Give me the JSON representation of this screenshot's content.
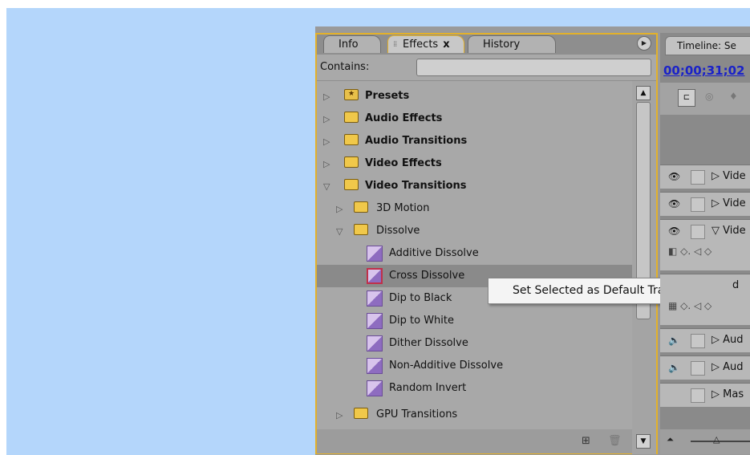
{
  "effects_panel": {
    "tabs": [
      {
        "label": "Info"
      },
      {
        "label": "Effects"
      },
      {
        "label": "History"
      }
    ],
    "close_glyph": "x",
    "contains_label": "Contains:",
    "contains_value": "",
    "tree": [
      {
        "label": "Presets",
        "twisty": "▷",
        "icon": "preset-folder-icon",
        "bold": true
      },
      {
        "label": "Audio Effects",
        "twisty": "▷",
        "icon": "folder-icon",
        "bold": true
      },
      {
        "label": "Audio Transitions",
        "twisty": "▷",
        "icon": "folder-icon",
        "bold": true
      },
      {
        "label": "Video Effects",
        "twisty": "▷",
        "icon": "folder-icon",
        "bold": true
      },
      {
        "label": "Video Transitions",
        "twisty": "▽",
        "icon": "folder-icon",
        "bold": true
      },
      {
        "label": "3D Motion",
        "twisty": "▷",
        "icon": "folder-icon"
      },
      {
        "label": "Dissolve",
        "twisty": "▽",
        "icon": "folder-icon"
      },
      {
        "label": "Additive Dissolve",
        "icon": "transition-icon"
      },
      {
        "label": "Cross Dissolve",
        "icon": "transition-icon",
        "selected": true
      },
      {
        "label": "Dip to Black",
        "icon": "transition-icon"
      },
      {
        "label": "Dip to White",
        "icon": "transition-icon"
      },
      {
        "label": "Dither Dissolve",
        "icon": "transition-icon"
      },
      {
        "label": "Non-Additive Dissolve",
        "icon": "transition-icon"
      },
      {
        "label": "Random Invert",
        "icon": "transition-icon"
      },
      {
        "label": "GPU Transitions",
        "twisty": "▷",
        "icon": "folder-icon"
      }
    ]
  },
  "context_menu": {
    "item": "Set Selected as Default Transition"
  },
  "timeline": {
    "tab_label": "Timeline: Se",
    "timecode": "00;00;31;02",
    "tracks": [
      {
        "label": "Vide",
        "type": "video"
      },
      {
        "label": "Vide",
        "type": "video"
      },
      {
        "label": "Vide",
        "type": "video",
        "expanded": true
      },
      {
        "label": "d",
        "type": "video"
      },
      {
        "label": "Aud",
        "type": "audio"
      },
      {
        "label": "Aud",
        "type": "audio"
      },
      {
        "label": "Mas",
        "type": "master"
      }
    ]
  },
  "colors": {
    "background": "#b4d6fb",
    "panel_highlight": "#e3b12b",
    "timecode": "#1a22c8"
  }
}
